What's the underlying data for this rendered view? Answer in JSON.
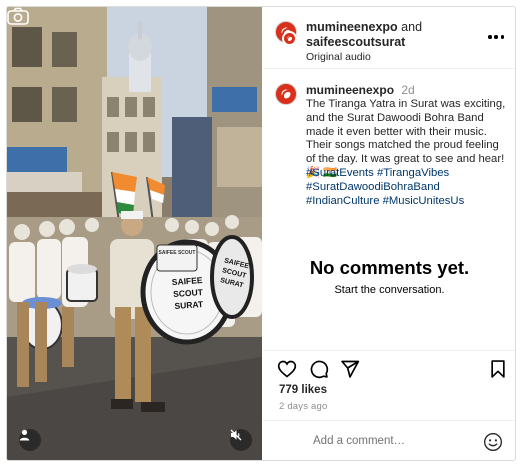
{
  "post": {
    "owner": "mumineenexpo",
    "and_text": "and",
    "collaborator": "saifeescoutsurat",
    "audio": "Original audio"
  },
  "media": {
    "drum_text_big": "SAIFEE SCOUT",
    "drum_text_big2": "SURAT",
    "drum_text_right": "SAIFEE SCOUT",
    "drum_text_right2": "SURAT",
    "drum_small": "SAIFEE SCOUT"
  },
  "caption": {
    "username": "mumineenexpo",
    "time": "2d",
    "text": "The Tiranga Yatra in Surat was exciting, and the Surat Dawoodi Bohra Band made it even better with their music. Their songs matched the proud feeling of the day. It was great to see and hear! 🎉 🇮🇳",
    "hashtags": "#SuratEvents #TirangaVibes #SuratDawoodiBohraBand #IndianCulture #MusicUnitesUs"
  },
  "comments": {
    "empty_title": "No comments yet.",
    "empty_subtitle": "Start the conversation."
  },
  "stats": {
    "likes": "779 likes",
    "posted": "2 days ago"
  },
  "composer": {
    "placeholder": "Add a comment…"
  },
  "icons": {
    "camera": "camera-icon",
    "user_tag": "user-tag-icon",
    "mute": "mute-icon",
    "more": "more-icon",
    "like": "heart-icon",
    "comment": "comment-icon",
    "share": "send-icon",
    "save": "bookmark-icon",
    "emoji": "emoji-icon"
  },
  "colors": {
    "hashtag": "#00376b",
    "muted_text": "#8e8e8e",
    "border": "#dbdbdb"
  }
}
